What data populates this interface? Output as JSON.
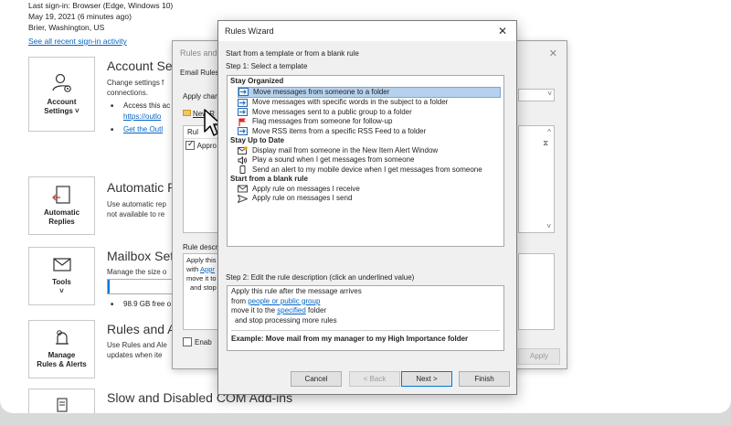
{
  "signin": {
    "line1": "Last sign-in: Browser (Edge, Windows 10)",
    "line2": "May 19, 2021 (6 minutes ago)",
    "line3": "Brier, Washington, US",
    "link": "See all recent sign-in activity"
  },
  "tiles": {
    "account": "Account\nSettings ˅",
    "automatic": "Automatic\nReplies",
    "tools": "Tools\n˅",
    "manage": "Manage\nRules & Alerts"
  },
  "sections": {
    "account_title": "Account Set",
    "account_desc": "Change settings f\nconnections.",
    "account_b1": "Access this ac",
    "account_b1_link": "https://outlo",
    "account_b2": "Get the Outl",
    "auto_title": "Automatic R",
    "auto_desc": "Use automatic rep\nnot available to re",
    "mailbox_title": "Mailbox Set",
    "mailbox_desc": "Manage the size o",
    "storage_text": "98.9 GB free o",
    "storage_used_fraction": 0.02,
    "rules_title": "Rules and A",
    "rules_desc": "Use Rules and Ale\nupdates when ite",
    "slow_title": "Slow and Disabled COM Add-ins"
  },
  "rules_alerts": {
    "title": "Rules and A",
    "tab": "Email Rules",
    "apply_changes": "Apply chan",
    "new_rule": "New R",
    "list_header": "Rul",
    "list_row": "Appro",
    "desc_label": "Rule descri",
    "desc_line1": "Apply this",
    "desc_line2": "with",
    "desc_line2_link": "Appr",
    "desc_line3": "move it to",
    "desc_line4": "and stop",
    "enable": "Enab",
    "apply_button": "Apply"
  },
  "wizard": {
    "title": "Rules Wizard",
    "intro": "Start from a template or from a blank rule",
    "step1": "Step 1: Select a template",
    "groups": [
      {
        "name": "Stay Organized",
        "items": [
          {
            "label": "Move messages from someone to a folder",
            "icon": "move-folder-icon"
          },
          {
            "label": "Move messages with specific words in the subject to a folder",
            "icon": "move-folder-icon"
          },
          {
            "label": "Move messages sent to a public group to a folder",
            "icon": "move-folder-icon"
          },
          {
            "label": "Flag messages from someone for follow-up",
            "icon": "flag-icon"
          },
          {
            "label": "Move RSS items from a specific RSS Feed to a folder",
            "icon": "move-folder-icon"
          }
        ]
      },
      {
        "name": "Stay Up to Date",
        "items": [
          {
            "label": "Display mail from someone in the New Item Alert Window",
            "icon": "alert-window-icon"
          },
          {
            "label": "Play a sound when I get messages from someone",
            "icon": "speaker-icon"
          },
          {
            "label": "Send an alert to my mobile device when I get messages from someone",
            "icon": "mobile-icon"
          }
        ]
      },
      {
        "name": "Start from a blank rule",
        "items": [
          {
            "label": "Apply rule on messages I receive",
            "icon": "envelope-icon"
          },
          {
            "label": "Apply rule on messages I send",
            "icon": "send-icon"
          }
        ]
      }
    ],
    "step2": "Step 2: Edit the rule description (click an underlined value)",
    "desc": {
      "line1": "Apply this rule after the message arrives",
      "line2_pre": "from ",
      "line2_link": "people or public group",
      "line3_pre": "move it to the ",
      "line3_link": "specified",
      "line3_post": " folder",
      "line4": "  and stop processing more rules",
      "example": "Example: Move mail from my manager to my High Importance folder"
    },
    "buttons": {
      "cancel": "Cancel",
      "back": "< Back",
      "next": "Next >",
      "finish": "Finish"
    }
  }
}
